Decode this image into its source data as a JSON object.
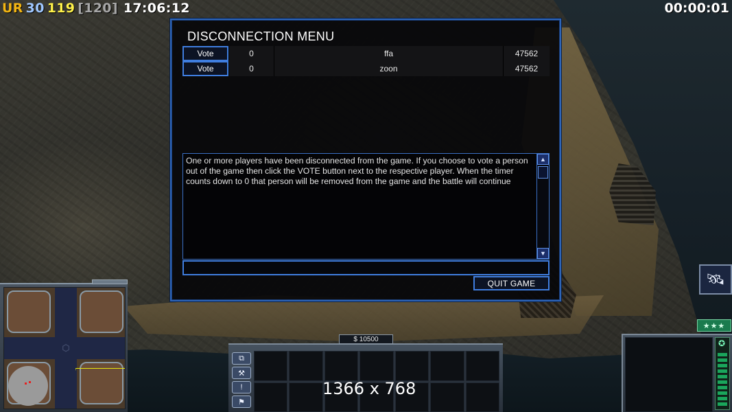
{
  "hud": {
    "ur_label": "UR",
    "val_a": "30",
    "val_b": "119",
    "val_c": "[120]",
    "clock": "17:06:12",
    "elapsed": "00:00:01"
  },
  "dialog": {
    "title": "DISCONNECTION MENU",
    "players": [
      {
        "vote_label": "Vote",
        "count": "0",
        "name": "ffa",
        "ping": "47562"
      },
      {
        "vote_label": "Vote",
        "count": "0",
        "name": "zoon",
        "ping": "47562"
      }
    ],
    "message": "One or more players have been disconnected from the game. If you choose to vote a person out of the game then click the VOTE button next to the respective player. When the timer counts down to 0 that person will be removed from the game and the battle will continue",
    "chat_value": "",
    "quit_label": "QUIT GAME"
  },
  "money": "$ 10500",
  "resolution_text": "1366 x 768",
  "rank_stars": "★★★",
  "colors": {
    "accent_blue": "#3f7ee0",
    "ur": "#f2b514",
    "val_a": "#9fc7ff",
    "val_b": "#fff24a"
  },
  "icons": {
    "cmd": [
      "windows-icon",
      "wrench-icon",
      "info-icon",
      "waypoint-icon"
    ],
    "general_power": "satellite-icon",
    "power": "star-icon"
  }
}
